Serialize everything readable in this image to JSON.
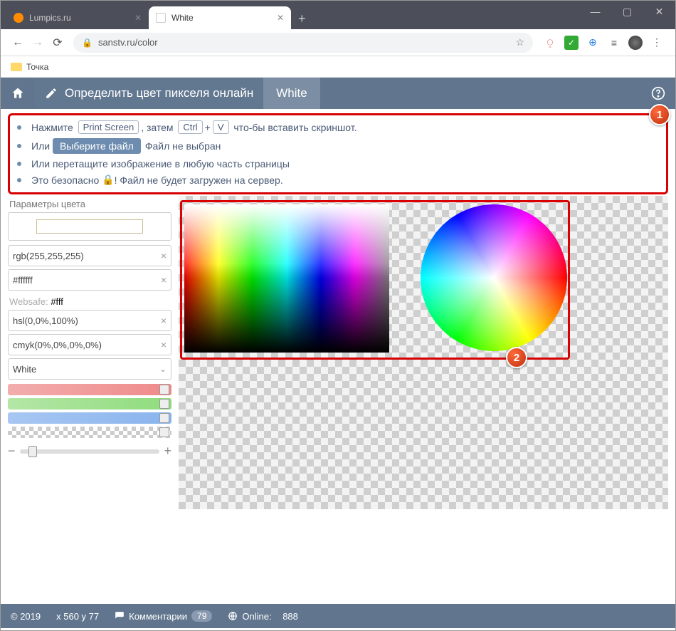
{
  "window": {
    "tabs": [
      {
        "title": "Lumpics.ru"
      },
      {
        "title": "White"
      }
    ],
    "controls": {
      "min": "—",
      "max": "▢",
      "close": "✕"
    }
  },
  "toolbar": {
    "url": "sanstv.ru/color",
    "bookmark_folder": "Точка"
  },
  "header": {
    "slogan": "Определить цвет пикселя онлайн",
    "color_name": "White"
  },
  "instructions": {
    "badge1": "1",
    "line1_a": "Нажмите",
    "key_print": "Print Screen",
    "line1_b": ", затем",
    "key_ctrl": "Ctrl",
    "plus": "+",
    "key_v": "V",
    "line1_c": "что-бы вставить скриншот.",
    "line2_a": "Или",
    "choose_btn": "Выберите файл",
    "line2_b": "Файл не выбран",
    "line3": "Или перетащите изображение в любую часть страницы",
    "line4_a": "Это безопасно",
    "line4_b": "! Файл не будет загружен на сервер."
  },
  "params": {
    "title": "Параметры цвета",
    "rgb": "rgb(255,255,255)",
    "hex": "#ffffff",
    "websafe_label": "Websafe:",
    "websafe_value": "#fff",
    "hsl": "hsl(0,0%,100%)",
    "cmyk": "cmyk(0%,0%,0%,0%)",
    "name": "White"
  },
  "canvas": {
    "badge2": "2"
  },
  "footer": {
    "copyright": "© 2019",
    "coords": "x 560 y 77",
    "comments_label": "Комментарии",
    "comments_count": "79",
    "online_label": "Online:",
    "online_count": "888"
  }
}
